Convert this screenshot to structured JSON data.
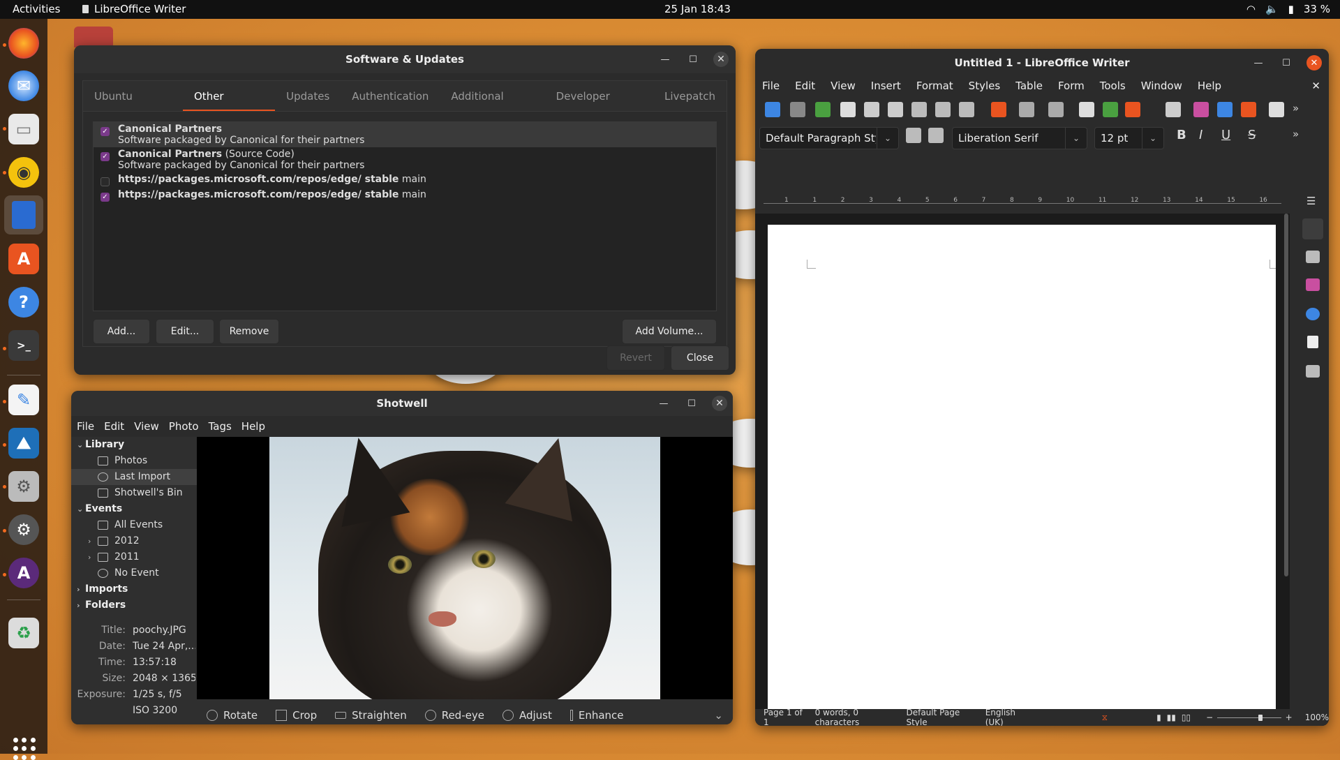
{
  "topbar": {
    "activities": "Activities",
    "app_name": "LibreOffice Writer",
    "clock": "25 Jan  18:43",
    "battery": "33 %"
  },
  "dock": {
    "apps": [
      "Firefox",
      "Thunderbird",
      "Files",
      "Rhythmbox",
      "LibreOffice Writer",
      "Ubuntu Software",
      "Help",
      "Terminal",
      "Text Editor",
      "Shotwell",
      "Software & Updates",
      "Settings",
      "Update Manager",
      "Trash"
    ]
  },
  "software_updates": {
    "title": "Software & Updates",
    "tabs": [
      "Ubuntu Software",
      "Other Software",
      "Updates",
      "Authentication",
      "Additional Drivers",
      "Developer Options",
      "Livepatch"
    ],
    "sources": [
      {
        "name": "Canonical Partners",
        "suffix": "",
        "desc": "Software packaged by Canonical for their partners",
        "checked": true
      },
      {
        "name": "Canonical Partners",
        "suffix": "(Source Code)",
        "desc": "Software packaged by Canonical for their partners",
        "checked": true
      },
      {
        "name": "https://packages.microsoft.com/repos/edge/ stable",
        "suffix": "main",
        "desc": "",
        "checked": false
      },
      {
        "name": "https://packages.microsoft.com/repos/edge/ stable",
        "suffix": "main",
        "desc": "",
        "checked": true
      }
    ],
    "buttons": {
      "add": "Add...",
      "edit": "Edit...",
      "remove": "Remove",
      "add_volume": "Add Volume...",
      "revert": "Revert",
      "close": "Close"
    }
  },
  "shotwell": {
    "title": "Shotwell",
    "menu": [
      "File",
      "Edit",
      "View",
      "Photo",
      "Tags",
      "Help"
    ],
    "tree": {
      "library": "Library",
      "photos": "Photos",
      "last_import": "Last Import",
      "bin": "Shotwell's Bin",
      "events": "Events",
      "all_events": "All Events",
      "y2012": "2012",
      "y2011": "2011",
      "no_event": "No Event",
      "imports": "Imports",
      "folders": "Folders"
    },
    "props": {
      "title_k": "Title:",
      "title_v": "poochy.JPG",
      "date_k": "Date:",
      "date_v": "Tue 24 Apr,...",
      "time_k": "Time:",
      "time_v": "13:57:18",
      "size_k": "Size:",
      "size_v": "2048 × 1365",
      "exposure_k": "Exposure:",
      "exposure_v": "1/25 s, f/5",
      "iso_v": "ISO 3200"
    },
    "tools": [
      "Rotate",
      "Crop",
      "Straighten",
      "Red-eye",
      "Adjust",
      "Enhance"
    ]
  },
  "writer": {
    "title": "Untitled 1 - LibreOffice Writer",
    "menu": [
      "File",
      "Edit",
      "View",
      "Insert",
      "Format",
      "Styles",
      "Table",
      "Form",
      "Tools",
      "Window",
      "Help"
    ],
    "paragraph_style": "Default Paragraph Styl",
    "font_name": "Liberation Serif",
    "font_size": "12 pt",
    "ruler_numbers": [
      "1",
      "1",
      "2",
      "3",
      "4",
      "5",
      "6",
      "7",
      "8",
      "9",
      "10",
      "11",
      "12",
      "13",
      "14",
      "15",
      "16"
    ],
    "status": {
      "page": "Page 1 of 1",
      "words": "0 words, 0 characters",
      "page_style": "Default Page Style",
      "language": "English (UK)",
      "zoom": "100%"
    }
  }
}
